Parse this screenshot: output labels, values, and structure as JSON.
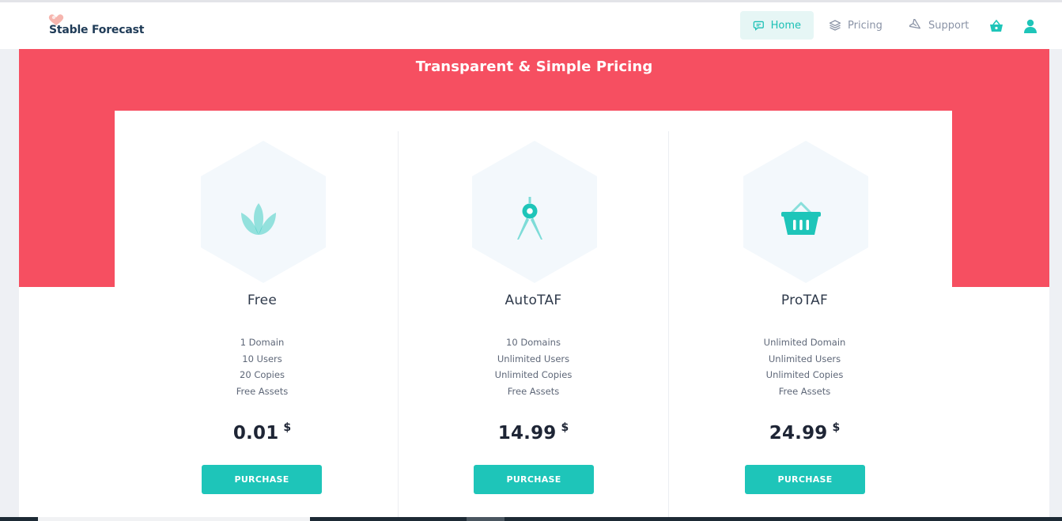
{
  "brand": {
    "name": "Stable Forecast",
    "logo_icon": "heart-hands-icon"
  },
  "nav": {
    "items": [
      {
        "label": "Home",
        "icon": "chat-bubble-icon",
        "active": true
      },
      {
        "label": "Pricing",
        "icon": "layers-icon",
        "active": false
      },
      {
        "label": "Support",
        "icon": "paper-plane-icon",
        "active": false
      }
    ],
    "cart_icon": "shopping-basket-icon",
    "user_icon": "user-icon"
  },
  "hero": {
    "title": "Transparent & Simple Pricing"
  },
  "plans": [
    {
      "name": "Free",
      "icon": "lotus-icon",
      "features": [
        "1 Domain",
        "10 Users",
        "20 Copies",
        "Free Assets"
      ],
      "price": "0.01",
      "currency": "$",
      "button_label": "PURCHASE"
    },
    {
      "name": "AutoTAF",
      "icon": "compass-icon",
      "features": [
        "10 Domains",
        "Unlimited Users",
        "Unlimited Copies",
        "Free Assets"
      ],
      "price": "14.99",
      "currency": "$",
      "button_label": "PURCHASE"
    },
    {
      "name": "ProTAF",
      "icon": "basket-icon",
      "features": [
        "Unlimited Domain",
        "Unlimited Users",
        "Unlimited Copies",
        "Free Assets"
      ],
      "price": "24.99",
      "currency": "$",
      "button_label": "PURCHASE"
    }
  ],
  "colors": {
    "accent": "#1ec5b9",
    "hero": "#f64f61",
    "nav_active_bg": "#e6f6f5",
    "text_dark": "#1e2535",
    "muted": "#8a93a6"
  }
}
